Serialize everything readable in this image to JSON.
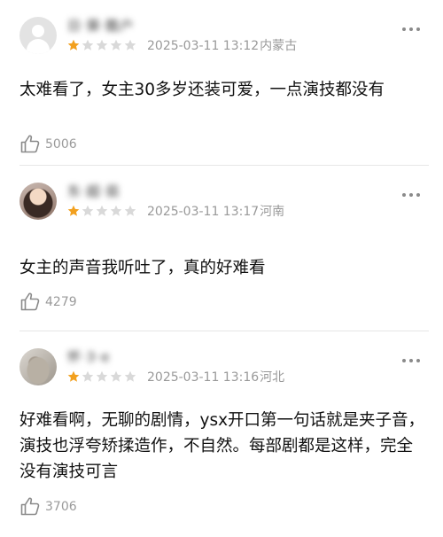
{
  "colors": {
    "star_filled": "#f2a01e",
    "star_empty": "#d9d9d9",
    "meta": "#999999"
  },
  "comments": [
    {
      "username": "日·葵·酷户",
      "rating": 1,
      "max_rating": 5,
      "date": "2025-03-11 13:12",
      "location": "内蒙古",
      "text": "太难看了，女主30多岁还装可爱，一点演技都没有",
      "likes": "5006",
      "avatar": "default-avatar-icon"
    },
    {
      "username": "东·超·茹",
      "rating": 1,
      "max_rating": 5,
      "date": "2025-03-11 13:17",
      "location": "河南",
      "text": "女主的声音我听吐了，真的好难看",
      "likes": "4279",
      "avatar": "photo"
    },
    {
      "username": "怀·3·e",
      "rating": 1,
      "max_rating": 5,
      "date": "2025-03-11 13:16",
      "location": "河北",
      "text": "好难看啊，无聊的剧情，ysx开口第一句话就是夹子音，演技也浮夸矫揉造作，不自然。每部剧都是这样，完全没有演技可言",
      "likes": "3706",
      "avatar": "photo"
    }
  ]
}
